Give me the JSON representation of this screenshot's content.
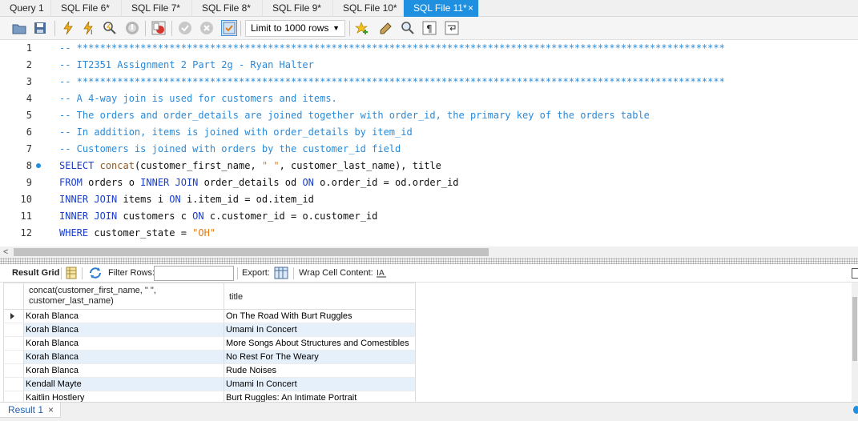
{
  "tabs": [
    {
      "label": "Query 1",
      "active": false
    },
    {
      "label": "SQL File 6*",
      "active": false
    },
    {
      "label": "SQL File 7*",
      "active": false
    },
    {
      "label": "SQL File 8*",
      "active": false
    },
    {
      "label": "SQL File 9*",
      "active": false
    },
    {
      "label": "SQL File 10*",
      "active": false
    },
    {
      "label": "SQL File 11*",
      "active": true
    }
  ],
  "tab_close": "×",
  "toolbar": {
    "limit_label": "Limit to 1000 rows",
    "icons": [
      "open-folder-icon",
      "save-icon",
      "execute-icon",
      "execute-current-icon",
      "explain-icon",
      "stop-icon",
      "toggle-error-icon",
      "commit-icon",
      "rollback-icon",
      "autocommit-icon",
      "add-snippet-icon",
      "beautify-icon",
      "find-icon",
      "invisible-chars-icon",
      "wrap-icon"
    ]
  },
  "editor": {
    "line_numbers": [
      "1",
      "2",
      "3",
      "4",
      "5",
      "6",
      "7",
      "8",
      "9",
      "10",
      "11",
      "12"
    ],
    "lines": {
      "l1": "-- ****************************************************************************************************************",
      "l2": "-- IT2351 Assignment 2 Part 2g - Ryan Halter",
      "l3": "-- ****************************************************************************************************************",
      "l4": "-- A 4-way join is used for customers and items.",
      "l5": "-- The orders and order_details are joined together with order_id, the primary key of the orders table",
      "l6": "-- In addition, items is joined with order_details by item_id",
      "l7": "-- Customers is joined with orders by the customer_id field",
      "l8": {
        "kw": "SELECT",
        "fn": "concat",
        "a": "(customer_first_name, ",
        "str": "\" \"",
        "b": ", customer_last_name), title"
      },
      "l9": {
        "kw1": "FROM",
        "a": " orders o ",
        "kw2": "INNER JOIN",
        "b": " order_details od ",
        "kw3": "ON",
        "c": " o.order_id = od.order_id"
      },
      "l10": {
        "kw1": "INNER JOIN",
        "a": " items i ",
        "kw2": "ON",
        "b": " i.item_id = od.item_id"
      },
      "l11": {
        "kw1": "INNER JOIN",
        "a": " customers c ",
        "kw2": "ON",
        "b": " c.customer_id = o.customer_id"
      },
      "l12": {
        "kw": "WHERE",
        "a": " customer_state = ",
        "str": "\"OH\""
      }
    }
  },
  "result_toolbar": {
    "result_grid": "Result Grid",
    "filter_rows": "Filter Rows:",
    "filter_value": "",
    "export": "Export:",
    "wrap": "Wrap Cell Content:"
  },
  "grid": {
    "columns": [
      "concat(customer_first_name, \" \",\ncustomer_last_name)",
      "title"
    ],
    "rows": [
      [
        "Korah Blanca",
        "On The Road With Burt Ruggles"
      ],
      [
        "Korah Blanca",
        "Umami In Concert"
      ],
      [
        "Korah Blanca",
        "More Songs About Structures and Comestibles"
      ],
      [
        "Korah Blanca",
        "No Rest For The Weary"
      ],
      [
        "Korah Blanca",
        "Rude Noises"
      ],
      [
        "Kendall Mayte",
        "Umami In Concert"
      ],
      [
        "Kaitlin Hostlery",
        "Burt Ruggles: An Intimate Portrait"
      ]
    ],
    "selected_row": 0
  },
  "bottom_tab": {
    "label": "Result 1",
    "close": "×"
  },
  "colors": {
    "accent": "#1f8fe0",
    "comment": "#2a8ad8",
    "keyword": "#1a3ec9",
    "string": "#e07b16",
    "row_alt": "#e6f0fb"
  }
}
